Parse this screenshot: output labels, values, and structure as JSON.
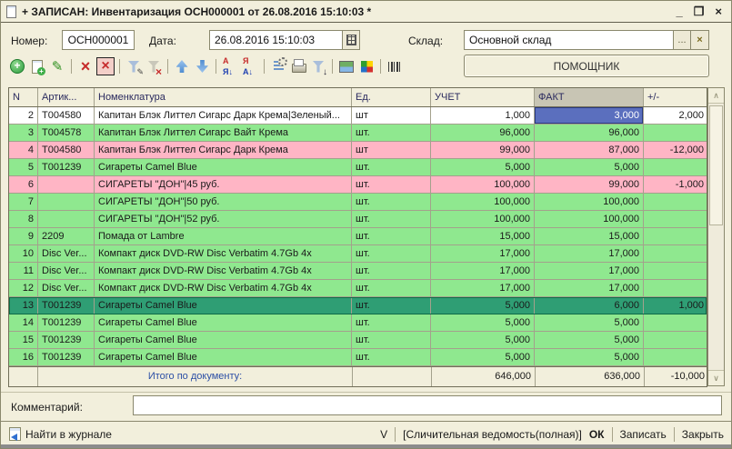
{
  "window": {
    "title": "+ ЗАПИСАН: Инвентаризация ОСН000001 от 26.08.2016 15:10:03 *",
    "controls": {
      "minimize": "_",
      "maximize": "❐",
      "close": "×"
    }
  },
  "form": {
    "number_label": "Номер:",
    "number_value": "ОСН000001",
    "date_label": "Дата:",
    "date_value": "26.08.2016 15:10:03",
    "warehouse_label": "Склад:",
    "warehouse_value": "Основной склад",
    "warehouse_ellipsis": "...",
    "warehouse_clear": "×",
    "assistant_button": "ПОМОЩНИК"
  },
  "toolbar": {
    "groups": [
      [
        "add",
        "copy",
        "edit"
      ],
      [
        "delete",
        "delete-marked"
      ],
      [
        "filter-settings",
        "filter-clear"
      ],
      [
        "move-up",
        "move-down"
      ],
      [
        "sort-asc",
        "sort-desc"
      ],
      [
        "list-settings",
        "print",
        "output-settings"
      ],
      [
        "image",
        "colors"
      ],
      [
        "barcode"
      ]
    ]
  },
  "table": {
    "columns": [
      "N",
      "Артик...",
      "Номенклатура",
      "Ед.",
      "УЧЕТ",
      "ФАКТ",
      "+/-"
    ],
    "selected_column": "ФАКТ",
    "rows": [
      {
        "n": "2",
        "article": "Т004580",
        "name": "Капитан Блэк Литтел Сигарс Дарк Крема|Зеленый...",
        "unit": "шт",
        "plan": "1,000",
        "fact": "3,000",
        "diff": "2,000",
        "state": "white",
        "fact_selected": true
      },
      {
        "n": "3",
        "article": "Т004578",
        "name": "Капитан Блэк Литтел Сигарс Вайт Крема",
        "unit": "шт.",
        "plan": "96,000",
        "fact": "96,000",
        "diff": "",
        "state": "green"
      },
      {
        "n": "4",
        "article": "Т004580",
        "name": "Капитан Блэк Литтел Сигарс Дарк Крема",
        "unit": "шт",
        "plan": "99,000",
        "fact": "87,000",
        "diff": "-12,000",
        "state": "pink"
      },
      {
        "n": "5",
        "article": "Т001239",
        "name": "Сигареты Camel Blue",
        "unit": "шт.",
        "plan": "5,000",
        "fact": "5,000",
        "diff": "",
        "state": "green"
      },
      {
        "n": "6",
        "article": "",
        "name": "СИГАРЕТЫ \"ДОН\"|45 руб.",
        "unit": "шт.",
        "plan": "100,000",
        "fact": "99,000",
        "diff": "-1,000",
        "state": "pink"
      },
      {
        "n": "7",
        "article": "",
        "name": "СИГАРЕТЫ \"ДОН\"|50 руб.",
        "unit": "шт.",
        "plan": "100,000",
        "fact": "100,000",
        "diff": "",
        "state": "green"
      },
      {
        "n": "8",
        "article": "",
        "name": "СИГАРЕТЫ \"ДОН\"|52 руб.",
        "unit": "шт.",
        "plan": "100,000",
        "fact": "100,000",
        "diff": "",
        "state": "green"
      },
      {
        "n": "9",
        "article": "2209",
        "name": "Помада от Lambre",
        "unit": "шт.",
        "plan": "15,000",
        "fact": "15,000",
        "diff": "",
        "state": "green"
      },
      {
        "n": "10",
        "article": "Disc Ver...",
        "name": "Компакт диск DVD-RW Disc Verbatim 4.7Gb 4x",
        "unit": "шт.",
        "plan": "17,000",
        "fact": "17,000",
        "diff": "",
        "state": "green"
      },
      {
        "n": "11",
        "article": "Disc Ver...",
        "name": "Компакт диск DVD-RW Disc Verbatim 4.7Gb 4x",
        "unit": "шт.",
        "plan": "17,000",
        "fact": "17,000",
        "diff": "",
        "state": "green"
      },
      {
        "n": "12",
        "article": "Disc Ver...",
        "name": "Компакт диск DVD-RW Disc Verbatim 4.7Gb 4x",
        "unit": "шт.",
        "plan": "17,000",
        "fact": "17,000",
        "diff": "",
        "state": "green"
      },
      {
        "n": "13",
        "article": "Т001239",
        "name": "Сигареты Camel Blue",
        "unit": "шт.",
        "plan": "5,000",
        "fact": "6,000",
        "diff": "1,000",
        "state": "selected"
      },
      {
        "n": "14",
        "article": "Т001239",
        "name": "Сигареты Camel Blue",
        "unit": "шт.",
        "plan": "5,000",
        "fact": "5,000",
        "diff": "",
        "state": "green"
      },
      {
        "n": "15",
        "article": "Т001239",
        "name": "Сигареты Camel Blue",
        "unit": "шт.",
        "plan": "5,000",
        "fact": "5,000",
        "diff": "",
        "state": "green"
      },
      {
        "n": "16",
        "article": "Т001239",
        "name": "Сигареты Camel Blue",
        "unit": "шт.",
        "plan": "5,000",
        "fact": "5,000",
        "diff": "",
        "state": "green"
      }
    ],
    "totals": {
      "label": "Итого по документу:",
      "plan": "646,000",
      "fact": "636,000",
      "diff": "-10,000"
    }
  },
  "comment": {
    "label": "Комментарий:",
    "value": ""
  },
  "statusbar": {
    "find_in_journal": "Найти в журнале",
    "v_indicator": "V",
    "mode": "[Сличительная ведомость(полная)]",
    "ok": "ОК",
    "save": "Записать",
    "close": "Закрыть"
  },
  "colors": {
    "row_green": "#8FE88F",
    "row_pink": "#FFB5C5",
    "row_selected": "#2F9E74",
    "cell_selected": "#5B6FBE",
    "fact_header": "#C8C5B4",
    "window_bg": "#F2EFDC"
  }
}
